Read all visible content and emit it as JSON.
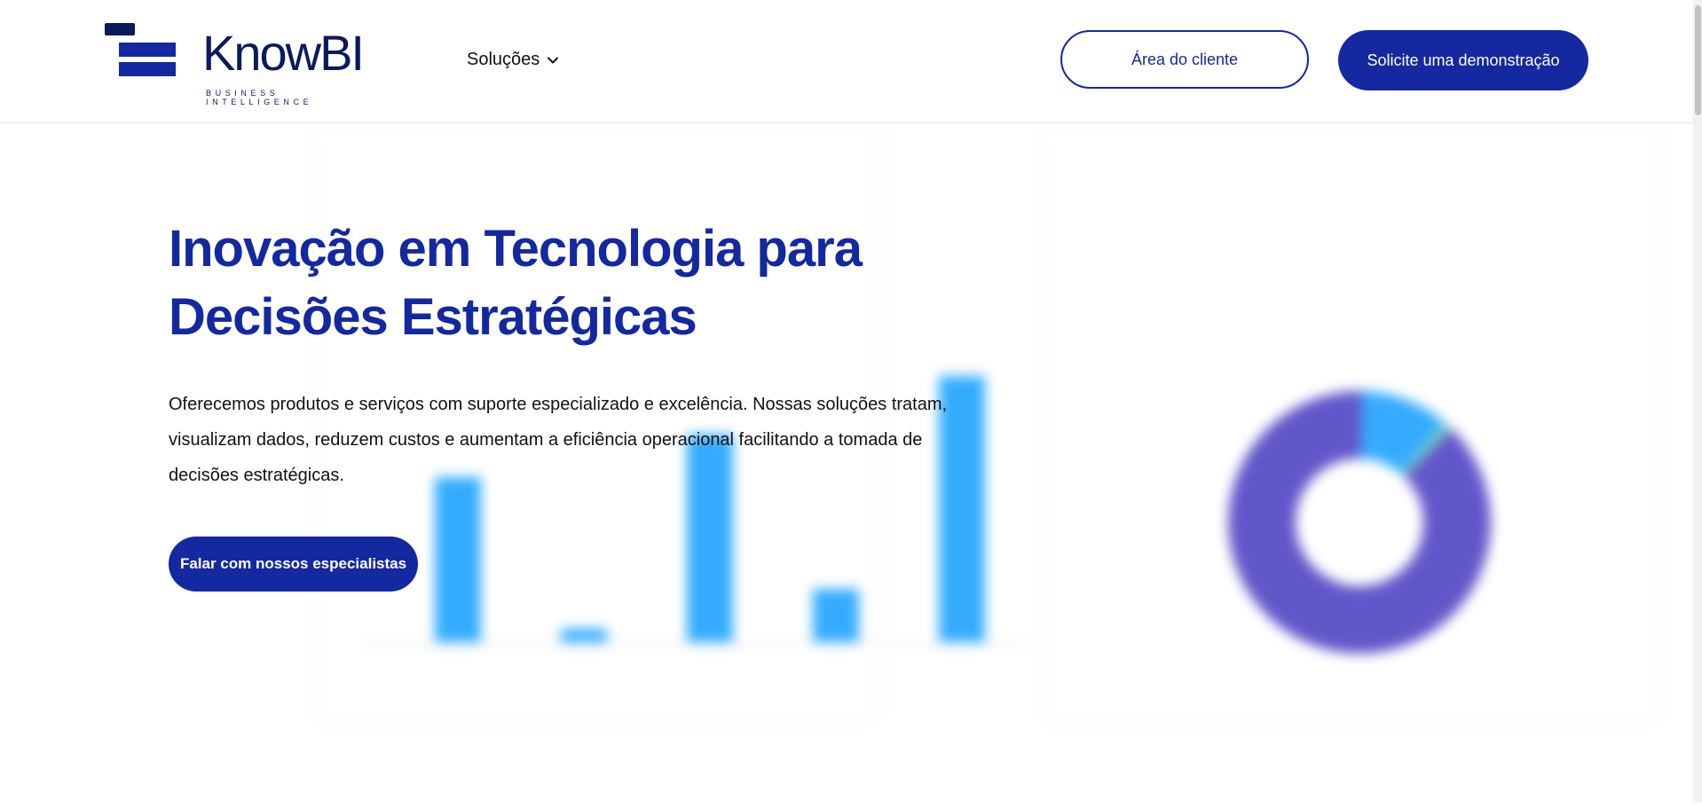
{
  "header": {
    "logo_word": "KnowBI",
    "logo_sub": "BUSINESS INTELLIGENCE",
    "nav_solucoes": "Soluções",
    "btn_cliente": "Área do cliente",
    "btn_demo": "Solicite uma demonstração"
  },
  "hero": {
    "title": "Inovação em Tecnologia para\nDecisões Estratégicas",
    "text": "Oferecemos produtos e serviços com suporte especializado e excelência. Nossas soluções tratam, visualizam dados, reduzem custos e aumentam a eficiência operacional facilitando a tomada de decisões estratégicas.",
    "cta": "Falar com nossos especialistas"
  },
  "colors": {
    "brand": "#1428a0",
    "brand_dark": "#0b1a5c",
    "bar": "#29a8ff",
    "donut_main": "#5a4fc7",
    "donut_slice": "#2aa7ff",
    "donut_small": "#7de0b0"
  },
  "icons": {
    "chevron": "chevron-down-icon",
    "logo": "knowbi-logo-mark"
  },
  "background_dashboard": {
    "bars": [
      0.62,
      0.05,
      0.78,
      0.2,
      1.0
    ],
    "donut_fractions": [
      0.88,
      0.11,
      0.01
    ]
  }
}
